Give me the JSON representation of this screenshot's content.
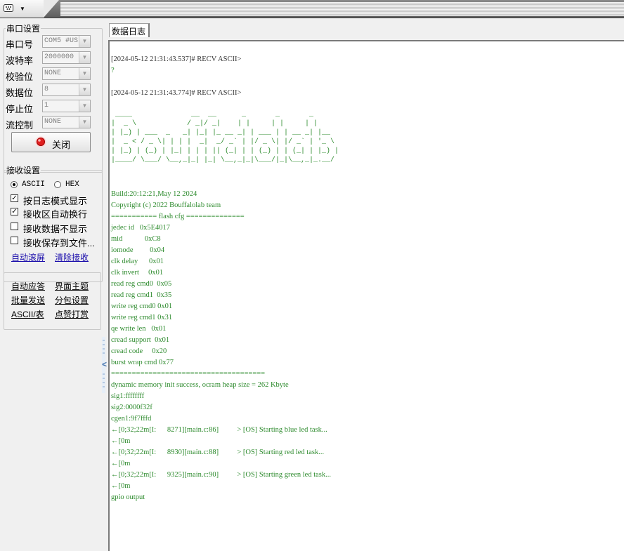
{
  "app": {
    "menu_arrow": "▼"
  },
  "serial": {
    "legend": "串口设置",
    "fields": [
      {
        "label": "串口号",
        "value": "COM5 #USI"
      },
      {
        "label": "波特率",
        "value": "2000000"
      },
      {
        "label": "校验位",
        "value": "NONE"
      },
      {
        "label": "数据位",
        "value": "8"
      },
      {
        "label": "停止位",
        "value": "1"
      },
      {
        "label": "流控制",
        "value": "NONE"
      }
    ],
    "close_label": "关闭",
    "led_color": "#e02020"
  },
  "recv": {
    "legend": "接收设置",
    "ascii_label": "ASCII",
    "hex_label": "HEX",
    "mode": "ASCII",
    "options": [
      {
        "label": "按日志模式显示",
        "checked": true
      },
      {
        "label": "接收区自动换行",
        "checked": true
      },
      {
        "label": "接收数据不显示",
        "checked": false
      },
      {
        "label": "接收保存到文件...",
        "checked": false
      }
    ],
    "auto_scroll": "自动滚屏",
    "clear_recv": "清除接收"
  },
  "tools": {
    "auto_reply": "自动应答",
    "theme": "界面主题",
    "batch_send": "批量发送",
    "packet_settings": "分包设置",
    "ascii_table": "ASCII/表",
    "donate": "点赞打赏"
  },
  "log": {
    "tab_label": "数据日志",
    "header_1": "[2024-05-12 21:31:43.537]# RECV ASCII>",
    "line_q": "?",
    "header_2": "[2024-05-12 21:31:43.774]# RECV ASCII>",
    "ascii_art": " ____              __  __      _       _       _\n|  _ \\            / _|/ _|    | |     | |     | |\n| |_) | ___  _   _| |_| |_ __ _| | ___ | | __ _| |__\n|  _ < / _ \\| | | |  _|  _/ _` | |/ _ \\| |/ _` | '_ \\\n| |_) | (_) | |_| | | | || (_| | | (_) | | (_| | |_) |\n|____/ \\___/ \\__,_|_| |_| \\__,_|_|\\___/|_|\\__,_|_.__/",
    "body": "Build:20:12:21,May 12 2024\nCopyright (c) 2022 Bouffalolab team\n=========== flash cfg ==============\njedec id   0x5E4017\nmid            0xC8\niomode         0x04\nclk delay      0x01\nclk invert     0x01\nread reg cmd0  0x05\nread reg cmd1  0x35\nwrite reg cmd0 0x01\nwrite reg cmd1 0x31\nqe write len   0x01\ncread support  0x01\ncread code     0x20\nburst wrap cmd 0x77\n=====================================\ndynamic memory init success, ocram heap size = 262 Kbyte\nsig1:ffffffff\nsig2:0000f32f\ncgen1:9f7fffd\n←[0;32;22m[I:      8271][main.c:86]          > [OS] Starting blue led task...\n←[0m\n←[0;32;22m[I:      8930][main.c:88]          > [OS] Starting red led task...\n←[0m\n←[0;32;22m[I:      9325][main.c:90]          > [OS] Starting green led task...\n←[0m\ngpio output",
    "text_color": "#2e8b2e"
  }
}
